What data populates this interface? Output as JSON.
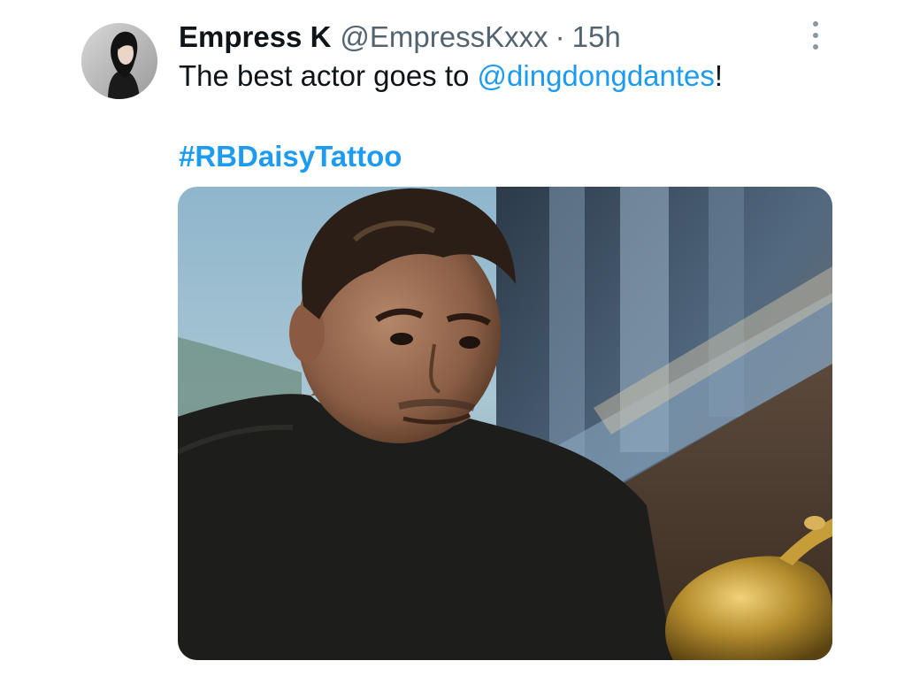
{
  "tweet": {
    "author": {
      "display_name": "Empress K",
      "handle": "@EmpressKxxx"
    },
    "separator": "·",
    "time": "15h",
    "text_before": "The best actor goes to ",
    "mention": "@dingdongdantes",
    "text_after": "!",
    "hashtag": "#RBDaisyTattoo",
    "more_icon": "more-vertical-icon",
    "accent_color": "#1d9bf0"
  }
}
